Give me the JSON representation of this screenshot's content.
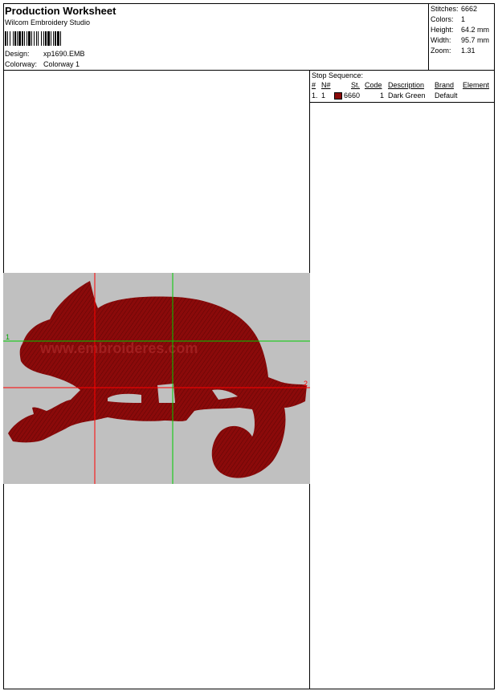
{
  "header": {
    "title": "Production Worksheet",
    "subtitle": "Wilcom Embroidery Studio",
    "design_label": "Design:",
    "design_value": "xp1690.EMB",
    "colorway_label": "Colorway:",
    "colorway_value": "Colorway 1"
  },
  "stats": {
    "stitches_label": "Stitches:",
    "stitches_value": "6662",
    "colors_label": "Colors:",
    "colors_value": "1",
    "height_label": "Height:",
    "height_value": "64.2 mm",
    "width_label": "Width:",
    "width_value": "95.7 mm",
    "zoom_label": "Zoom:",
    "zoom_value": "1.31"
  },
  "design": {
    "thread_color": "#8b0a0a",
    "canvas_color": "#c0c0c0",
    "start_marker": "1",
    "end_marker": "2",
    "watermark": "www.embroideres.com"
  },
  "stop_sequence": {
    "title": "Stop Sequence:",
    "columns": {
      "num": "#",
      "n": "N#",
      "st": "St.",
      "code": "Code",
      "description": "Description",
      "brand": "Brand",
      "element": "Element"
    },
    "rows": [
      {
        "num": "1.",
        "n": "1",
        "color": "#8b0a0a",
        "st": "6660",
        "code": "1",
        "description": "Dark Green",
        "brand": "Default",
        "element": ""
      }
    ]
  }
}
